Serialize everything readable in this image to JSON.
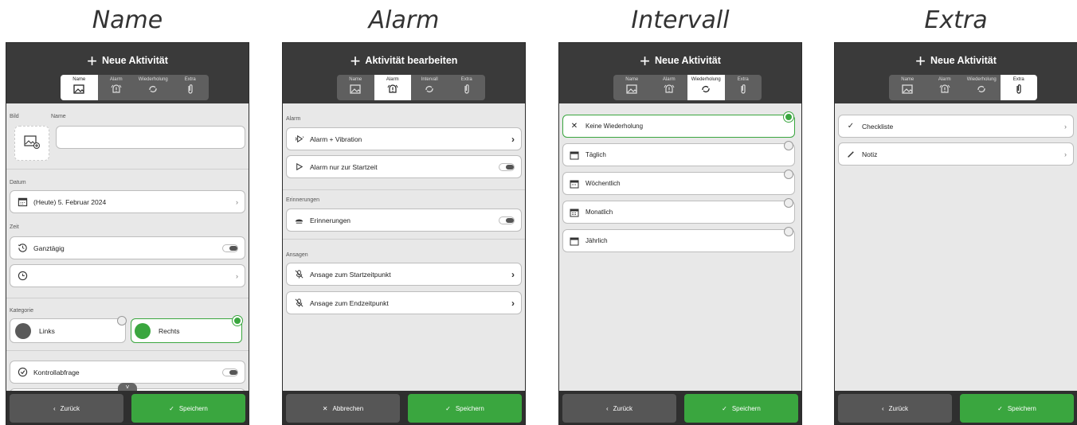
{
  "titles": [
    "Name",
    "Alarm",
    "Intervall",
    "Extra"
  ],
  "colors": {
    "header": "#3a3a3a",
    "accent_green": "#3aa63f",
    "background": "#e8e8e8"
  },
  "screen1": {
    "header": "Neue Aktivität",
    "tabs": [
      "Name",
      "Alarm",
      "Wiederholung",
      "Extra"
    ],
    "bild_label": "Bild",
    "name_label": "Name",
    "name_value": "",
    "datum_label": "Datum",
    "datum_value": "(Heute) 5. Februar 2024",
    "zeit_label": "Zeit",
    "ganztaegig": "Ganztägig",
    "kategorie_label": "Kategorie",
    "links": "Links",
    "rechts": "Rechts",
    "kontrollabfrage": "Kontrollabfrage",
    "back": "Zurück",
    "save": "Speichern"
  },
  "screen2": {
    "header": "Aktivität bearbeiten",
    "tabs": [
      "Name",
      "Alarm",
      "Intervall",
      "Extra"
    ],
    "alarm_label": "Alarm",
    "alarm_vibration": "Alarm + Vibration",
    "alarm_start": "Alarm nur zur Startzeit",
    "erinnerungen_label": "Erinnerungen",
    "erinnerungen": "Erinnerungen",
    "ansagen_label": "Ansagen",
    "ansage_start": "Ansage zum Startzeitpunkt",
    "ansage_end": "Ansage zum Endzeitpunkt",
    "cancel": "Abbrechen",
    "save": "Speichern"
  },
  "screen3": {
    "header": "Neue Aktivität",
    "tabs": [
      "Name",
      "Alarm",
      "Wiederholung",
      "Extra"
    ],
    "options": [
      "Keine Wiederholung",
      "Täglich",
      "Wöchentlich",
      "Monatlich",
      "Jährlich"
    ],
    "back": "Zurück",
    "save": "Speichern"
  },
  "screen4": {
    "header": "Neue Aktivität",
    "tabs": [
      "Name",
      "Alarm",
      "Wiederholung",
      "Extra"
    ],
    "checkliste": "Checkliste",
    "notiz": "Notiz",
    "back": "Zurück",
    "save": "Speichern"
  }
}
